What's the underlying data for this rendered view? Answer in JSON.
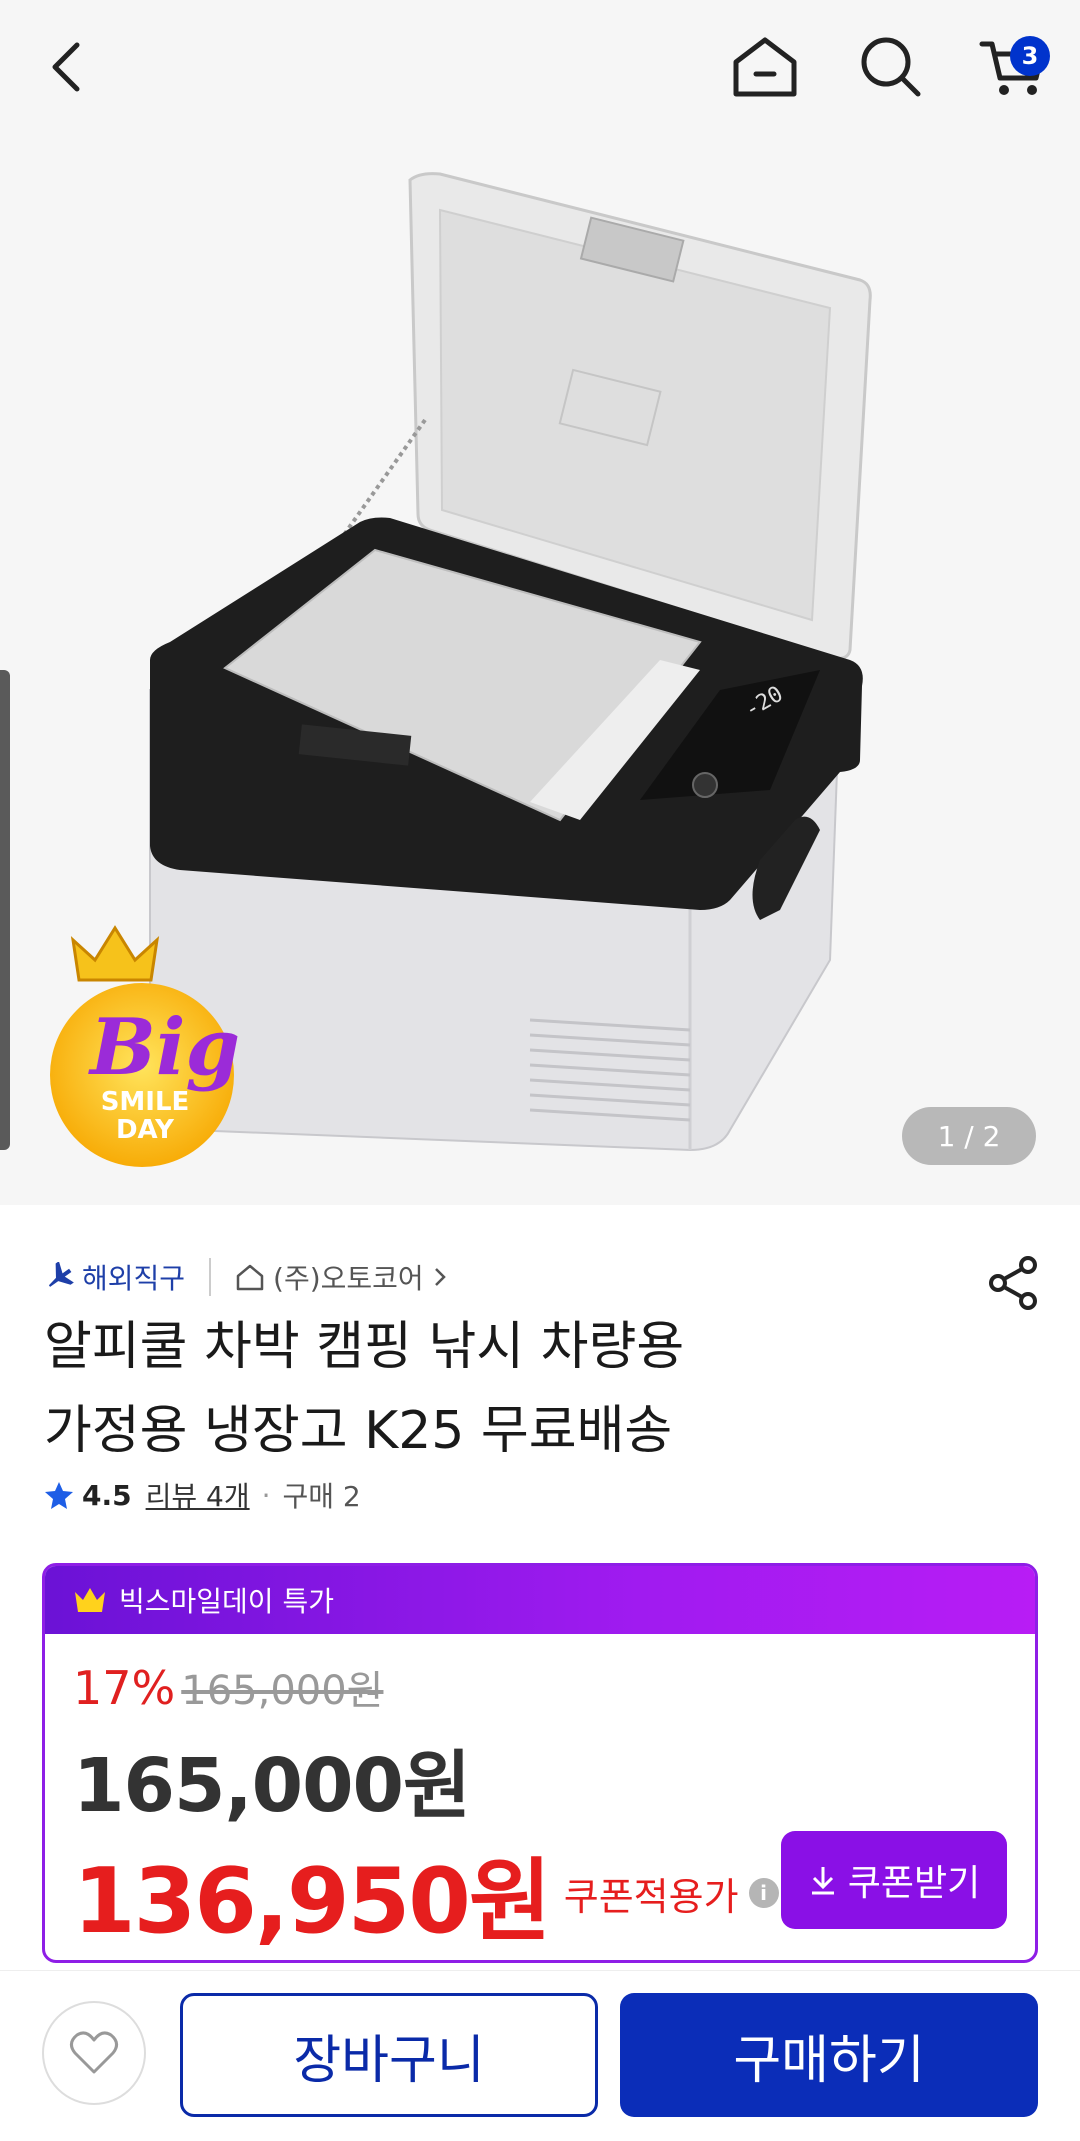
{
  "header": {
    "cart_count": "3"
  },
  "gallery": {
    "counter": "1 / 2",
    "badge": {
      "big": "Big",
      "line1": "SMILE",
      "line2": "DAY"
    }
  },
  "product": {
    "overseas_label": "해외직구",
    "store_name": "(주)오토코어",
    "title_line1": "알피쿨 차박 캠핑 낚시 차량용",
    "title_line2": "가정용 냉장고 K25 무료배송",
    "rating": "4.5",
    "review_label": "리뷰 4개",
    "purchase_label": "구매 2"
  },
  "price": {
    "event_label": "빅스마일데이 특가",
    "discount_rate": "17%",
    "original_price": "165,000원",
    "sale_price": "165,000원",
    "final_price": "136,950원",
    "final_label": "쿠폰적용가",
    "coupon_button": "쿠폰받기"
  },
  "bottom": {
    "cart_button": "장바구니",
    "buy_button": "구매하기"
  },
  "colors": {
    "accent_purple": "#8a10e6",
    "primary_blue": "#0b2db8",
    "price_red": "#e61e1e"
  }
}
